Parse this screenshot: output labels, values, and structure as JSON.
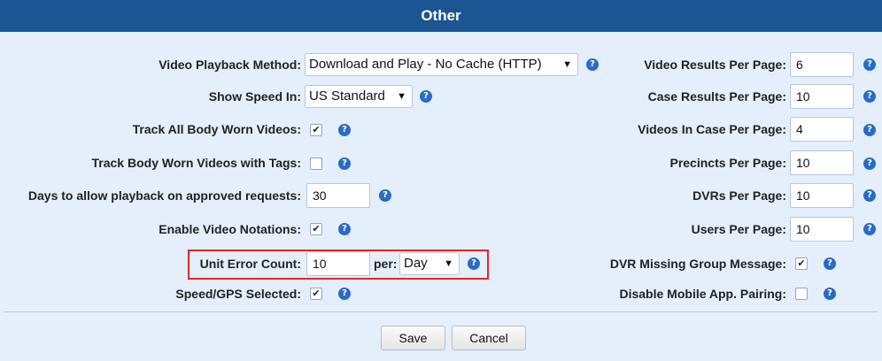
{
  "header": {
    "title": "Other"
  },
  "left": {
    "video_playback": {
      "label": "Video Playback Method:",
      "value": "Download and Play - No Cache (HTTP)"
    },
    "show_speed": {
      "label": "Show Speed In:",
      "value": "US Standard"
    },
    "track_all_body_worn": {
      "label": "Track All Body Worn Videos:",
      "checked": "✔"
    },
    "track_body_worn_tags": {
      "label": "Track Body Worn Videos with Tags:",
      "checked": ""
    },
    "days_playback": {
      "label": "Days to allow playback on approved requests:",
      "value": "30"
    },
    "enable_video_notations": {
      "label": "Enable Video Notations:",
      "checked": "✔"
    },
    "unit_error_count": {
      "label": "Unit Error Count:",
      "value": "10",
      "per_label": "per:",
      "per_value": "Day"
    },
    "speed_gps_selected": {
      "label": "Speed/GPS Selected:",
      "checked": "✔"
    }
  },
  "right": {
    "video_results": {
      "label": "Video Results Per Page:",
      "value": "6"
    },
    "case_results": {
      "label": "Case Results Per Page:",
      "value": "10"
    },
    "videos_in_case": {
      "label": "Videos In Case Per Page:",
      "value": "4"
    },
    "precincts": {
      "label": "Precincts Per Page:",
      "value": "10"
    },
    "dvrs": {
      "label": "DVRs Per Page:",
      "value": "10"
    },
    "users": {
      "label": "Users Per Page:",
      "value": "10"
    },
    "dvr_missing_group": {
      "label": "DVR Missing Group Message:",
      "checked": "✔"
    },
    "disable_mobile_pairing": {
      "label": "Disable Mobile App. Pairing:",
      "checked": ""
    }
  },
  "buttons": {
    "save": "Save",
    "cancel": "Cancel"
  },
  "icons": {
    "help_glyph": "?",
    "dropdown_glyph": "▼"
  },
  "colors": {
    "header_bg": "#1b5592",
    "panel_bg": "#e4effb",
    "help_icon": "#2a6bc4",
    "highlight": "#e2262b"
  }
}
